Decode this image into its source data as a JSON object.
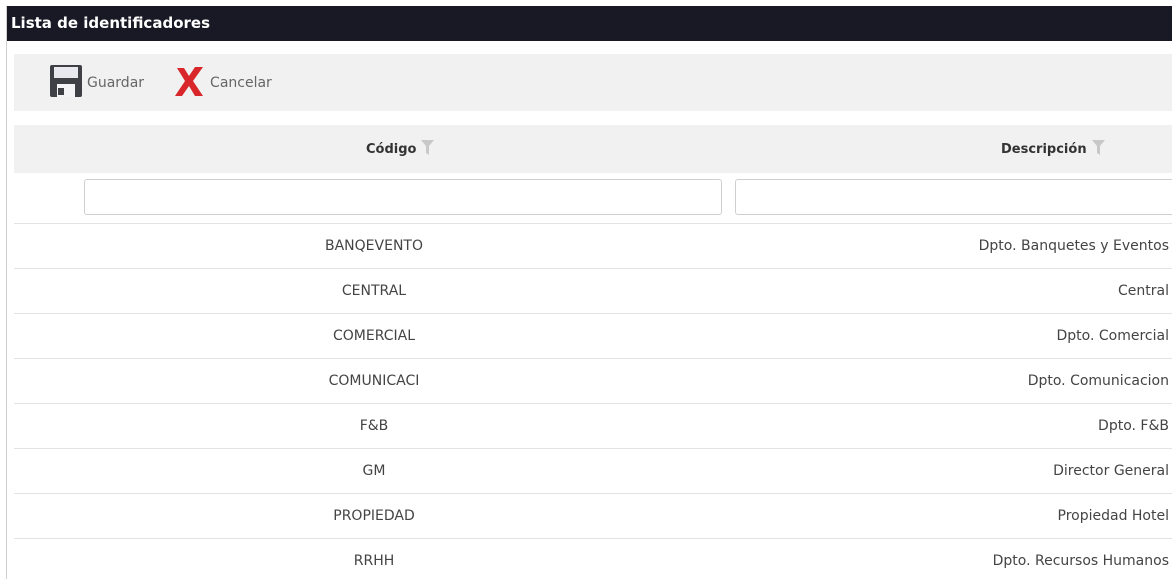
{
  "window": {
    "title": "Lista de identificadores"
  },
  "toolbar": {
    "save_label": "Guardar",
    "cancel_label": "Cancelar"
  },
  "table": {
    "columns": {
      "code": "Código",
      "description": "Descripción"
    },
    "filters": {
      "code_value": "",
      "description_value": ""
    },
    "rows": [
      {
        "code": "BANQEVENTO",
        "description": "Dpto. Banquetes y Eventos"
      },
      {
        "code": "CENTRAL",
        "description": "Central"
      },
      {
        "code": "COMERCIAL",
        "description": "Dpto. Comercial"
      },
      {
        "code": "COMUNICACI",
        "description": "Dpto. Comunicacion"
      },
      {
        "code": "F&B",
        "description": "Dpto. F&B"
      },
      {
        "code": "GM",
        "description": "Director General"
      },
      {
        "code": "PROPIEDAD",
        "description": "Propiedad Hotel"
      },
      {
        "code": "RRHH",
        "description": "Dpto. Recursos Humanos"
      }
    ]
  },
  "icons": {
    "save": "floppy-disk-icon",
    "cancel": "red-x-icon",
    "filter": "funnel-icon"
  },
  "colors": {
    "titlebar_bg": "#191825",
    "toolbar_bg": "#f1f1f1",
    "cancel_red": "#d9262b",
    "save_icon": "#3f3f46"
  }
}
